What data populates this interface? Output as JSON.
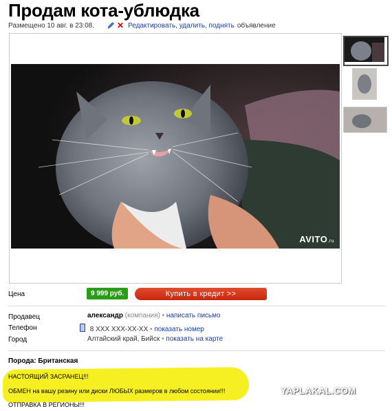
{
  "ad": {
    "title": "Продам кота-ублюдка",
    "posted": "Размещено 10 авг. в 23:08.",
    "edit_link": "Редактировать, удалить, поднять",
    "edit_suffix": "объявление"
  },
  "photo": {
    "watermark": "AVITO",
    "watermark_suffix": ".ru",
    "thumbnails": [
      "thumb-1",
      "thumb-2",
      "thumb-3"
    ]
  },
  "price": {
    "label": "Цена",
    "value": "9 999 руб.",
    "credit_button": "Купить в кредит >>"
  },
  "seller": {
    "label": "Продавец",
    "name": "александр",
    "type": "(компания)",
    "message_link": "написать письмо"
  },
  "phone": {
    "label": "Телефон",
    "value": "8 XXX XXX-XX-XX",
    "show_link": "показать номер"
  },
  "city": {
    "label": "Город",
    "value": "Алтайский край, Бийск",
    "map_link": "показать на карте"
  },
  "details": {
    "breed": "Порода: Британская",
    "line1": "НАСТОЯЩИЙ ЗАСРАНЕЦ!!!",
    "line2": "ОБМЕН на вашу резину или диски ЛЮБЫХ размеров в любом состоянии!!!",
    "line3": "ОТПРАВКА В РЕГИОНЫ!!!"
  },
  "watermark_site": "YAPLAKAL.COM",
  "colors": {
    "price_green": "#2a9d16",
    "credit_red": "#d6341a",
    "link_blue": "#1a3da8",
    "highlight_yellow": "#f6ef22"
  }
}
